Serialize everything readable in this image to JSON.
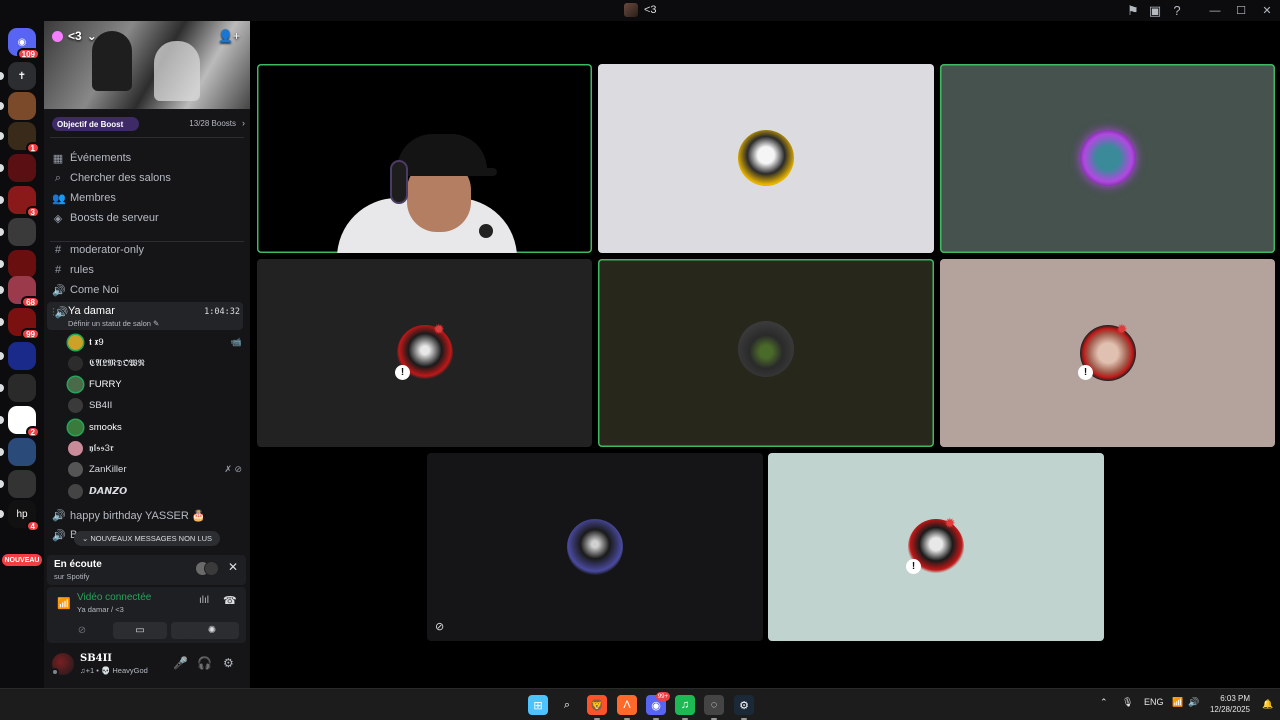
{
  "window": {
    "title": "<3",
    "icons": [
      "inbox-flag-icon",
      "screen-share-icon",
      "help-icon"
    ],
    "controls": [
      "—",
      "☐",
      "✕"
    ]
  },
  "rail": {
    "servers": [
      {
        "name": "discord-home",
        "badge": "109",
        "color": "#5865f2",
        "glyph": "◉"
      },
      {
        "name": "server-2",
        "badge": "",
        "color": "#2b2d31",
        "glyph": "✝"
      },
      {
        "name": "server-3",
        "badge": "",
        "color": "#7a4a2a",
        "glyph": ""
      },
      {
        "name": "server-4",
        "badge": "1",
        "color": "#3a2a1a",
        "glyph": ""
      },
      {
        "name": "server-5",
        "badge": "",
        "color": "#5a0f12",
        "glyph": ""
      },
      {
        "name": "server-6",
        "badge": "3",
        "color": "#8a1a1a",
        "glyph": ""
      },
      {
        "name": "server-7",
        "badge": "",
        "color": "#3a3a3a",
        "glyph": ""
      },
      {
        "name": "server-8",
        "badge": "",
        "color": "#6a0f10",
        "glyph": ""
      },
      {
        "name": "server-9",
        "badge": "68",
        "color": "#9a3a4a",
        "glyph": ""
      },
      {
        "name": "server-10",
        "badge": "99",
        "color": "#7a1010",
        "glyph": ""
      },
      {
        "name": "server-11",
        "badge": "",
        "color": "#1a2a8a",
        "glyph": ""
      },
      {
        "name": "server-12",
        "badge": "",
        "color": "#2a2a2a",
        "glyph": ""
      },
      {
        "name": "server-13",
        "badge": "2",
        "color": "#ffffff",
        "glyph": ""
      },
      {
        "name": "server-14",
        "badge": "",
        "color": "#2a4a7a",
        "glyph": ""
      },
      {
        "name": "server-15",
        "badge": "",
        "color": "#333333",
        "glyph": ""
      },
      {
        "name": "server-16",
        "badge": "4",
        "color": "#111111",
        "glyph": "hp"
      }
    ],
    "new_label": "NOUVEAU"
  },
  "server": {
    "name": "<3",
    "boost_goal": "Objectif de Boost",
    "boost_count": "13/28 Boosts"
  },
  "nav": [
    {
      "label": "Événements",
      "icon": "calendar-icon",
      "glyph": "▦"
    },
    {
      "label": "Chercher des salons",
      "icon": "browse-channels-icon",
      "glyph": "⌕"
    },
    {
      "label": "Membres",
      "icon": "members-icon",
      "glyph": "👥"
    },
    {
      "label": "Boosts de serveur",
      "icon": "boost-icon",
      "glyph": "◈"
    }
  ],
  "channels": [
    {
      "label": "moderator-only",
      "icon": "text-channel-icon",
      "glyph": "#"
    },
    {
      "label": "rules",
      "icon": "text-channel-icon",
      "glyph": "#"
    },
    {
      "label": "Come Noi",
      "icon": "voice-channel-icon",
      "glyph": "🔊"
    }
  ],
  "active_voice": {
    "name": "Ya damar",
    "status": "Définir un statut de salon ✎",
    "timer": "1:04:32"
  },
  "members": [
    {
      "name": "𝖙 𝖝9",
      "avatar_color": "#c9a227",
      "speaking": true,
      "flags": "📹"
    },
    {
      "name": "𝕮𝕬𝕷𝕸𝕯𝕺𝖂𝕹",
      "avatar_color": "#2c2c2c",
      "speaking": false,
      "flags": ""
    },
    {
      "name": "FURRY",
      "avatar_color": "#4a6a4a",
      "speaking": true,
      "flags": ""
    },
    {
      "name": "SB4II",
      "avatar_color": "#3a3a3a",
      "speaking": false,
      "flags": ""
    },
    {
      "name": "smooks",
      "avatar_color": "#3a7a3a",
      "speaking": true,
      "flags": ""
    },
    {
      "name": "𝖞𝖑𝖘𝖘3𝖗",
      "avatar_color": "#c98a9a",
      "speaking": false,
      "flags": ""
    },
    {
      "name": "ZanKiller",
      "avatar_color": "#555555",
      "speaking": false,
      "flags": "✗ ⊘"
    },
    {
      "name": "𝘿𝘼𝙉𝙕𝙊",
      "avatar_color": "#444444",
      "speaking": false,
      "flags": ""
    }
  ],
  "extra_channels": [
    {
      "label": "happy birthday YASSER 🎂",
      "icon": "voice-channel-icon",
      "glyph": "🔊"
    },
    {
      "label": "B",
      "icon": "voice-channel-icon",
      "glyph": "🔊"
    }
  ],
  "new_messages": "⌄ NOUVEAUX MESSAGES NON LUS",
  "listening": {
    "title": "En écoute",
    "subtitle": "sur Spotify"
  },
  "voice": {
    "status": "Vidéo connectée",
    "location": "Ya damar / <3"
  },
  "user": {
    "name": "SB4II",
    "status": "♫+1 • 💀 HeavyGod"
  },
  "tiles": [
    {
      "label": "tile-streamer-camera",
      "bg": "#000000",
      "speaking": true
    },
    {
      "label": "tile-user-2",
      "bg": "#dcdce0",
      "speaking": false
    },
    {
      "label": "tile-user-3",
      "bg": "#45524d",
      "speaking": true
    },
    {
      "label": "tile-user-4",
      "bg": "#222222",
      "speaking": false
    },
    {
      "label": "tile-user-5",
      "bg": "#27271b",
      "speaking": true
    },
    {
      "label": "tile-user-6",
      "bg": "#b4a39c",
      "speaking": false
    },
    {
      "label": "tile-user-7",
      "bg": "#151517",
      "speaking": false
    },
    {
      "label": "tile-user-8",
      "bg": "#c1d3ce",
      "speaking": false
    }
  ],
  "taskbar": {
    "apps": [
      {
        "name": "start-icon",
        "glyph": "⊞",
        "color": "#4cc2ff",
        "badge": ""
      },
      {
        "name": "search-icon",
        "glyph": "⌕",
        "color": "transparent",
        "badge": ""
      },
      {
        "name": "brave-icon",
        "glyph": "🦁",
        "color": "#fb542b",
        "badge": ""
      },
      {
        "name": "app-a-icon",
        "glyph": "Λ",
        "color": "#ff6a2b",
        "badge": ""
      },
      {
        "name": "discord-icon",
        "glyph": "◉",
        "color": "#5865f2",
        "badge": "99+"
      },
      {
        "name": "spotify-icon",
        "glyph": "♫",
        "color": "#1db954",
        "badge": ""
      },
      {
        "name": "app-circle-icon",
        "glyph": "◌",
        "color": "#444444",
        "badge": ""
      },
      {
        "name": "steam-icon",
        "glyph": "⚙",
        "color": "#1b2838",
        "badge": ""
      }
    ],
    "lang": "ENG",
    "time": "6:03 PM",
    "date": "12/28/2025"
  }
}
